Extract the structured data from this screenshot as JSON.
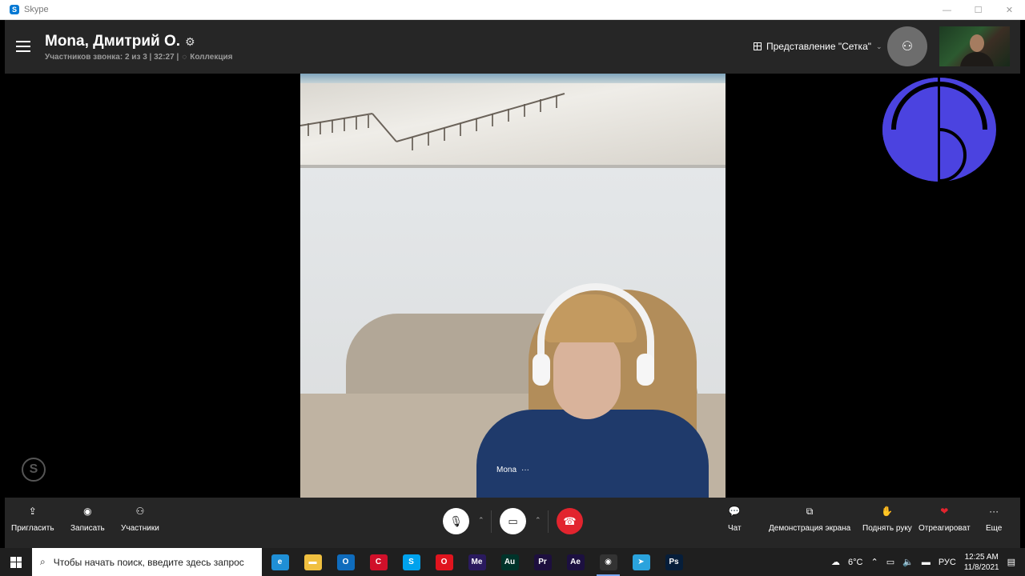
{
  "window": {
    "app_name": "Skype",
    "minimize": "—",
    "maximize": "☐",
    "close": "✕"
  },
  "header": {
    "title": "Mona, Дмитрий О.",
    "participants_info": "Участников звонка: 2 из 3 | 32:27 |",
    "collection_label": "Коллекция",
    "view_label": "Представление \"Сетка\""
  },
  "video": {
    "participant_name": "Mona",
    "more": "···"
  },
  "controls": {
    "invite": "Пригласить",
    "record": "Записать",
    "participants": "Участники",
    "chat": "Чат",
    "screen_share": "Демонстрация экрана",
    "raise_hand": "Поднять руку",
    "react": "Отреагироват",
    "more": "Еще"
  },
  "taskbar": {
    "search_placeholder": "Чтобы начать поиск, введите здесь запрос",
    "apps": [
      {
        "name": "edge",
        "label": "e",
        "color": "#1f8fd6"
      },
      {
        "name": "file-explorer",
        "label": "▬",
        "color": "#f0c040"
      },
      {
        "name": "outlook",
        "label": "O",
        "color": "#0f6cbd"
      },
      {
        "name": "app-red",
        "label": "C",
        "color": "#d0102a"
      },
      {
        "name": "skype",
        "label": "S",
        "color": "#00a2ed"
      },
      {
        "name": "opera",
        "label": "O",
        "color": "#e0141e"
      },
      {
        "name": "media-encoder",
        "label": "Me",
        "color": "#2a1a5e"
      },
      {
        "name": "audition",
        "label": "Au",
        "color": "#00332a"
      },
      {
        "name": "premiere",
        "label": "Pr",
        "color": "#1d0f3e"
      },
      {
        "name": "after-effects",
        "label": "Ae",
        "color": "#1c1040"
      },
      {
        "name": "obs",
        "label": "◉",
        "color": "#333333"
      },
      {
        "name": "telegram",
        "label": "➤",
        "color": "#2aa3dd"
      },
      {
        "name": "photoshop",
        "label": "Ps",
        "color": "#061e3a"
      }
    ],
    "weather": "6°C",
    "language": "РУС",
    "time": "12:25 AM",
    "date": "11/8/2021"
  },
  "colors": {
    "end_call": "#e2242e",
    "logo_blue": "#4b43e0",
    "toolbar": "#262626"
  }
}
